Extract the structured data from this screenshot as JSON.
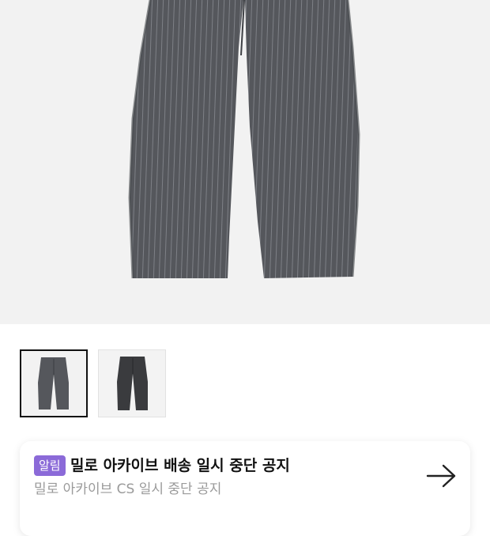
{
  "product": {
    "main_image": "product-image-gray-pinstripe-pants",
    "thumbnails": [
      {
        "name": "thumbnail-gray-pinstripe",
        "selected": true
      },
      {
        "name": "thumbnail-charcoal",
        "selected": false
      }
    ]
  },
  "notice": {
    "badge": "알림",
    "title": "밀로 아카이브 배송 일시 중단 공지",
    "subtitle": "밀로 아카이브 CS 일시 중단 공지",
    "arrow_icon": "arrow-right-icon"
  },
  "colors": {
    "badge_bg": "#8b6ad8",
    "hero_bg": "#f2f2f2",
    "pants_gray": "#55575c",
    "pants_charcoal": "#3a3b3e"
  }
}
